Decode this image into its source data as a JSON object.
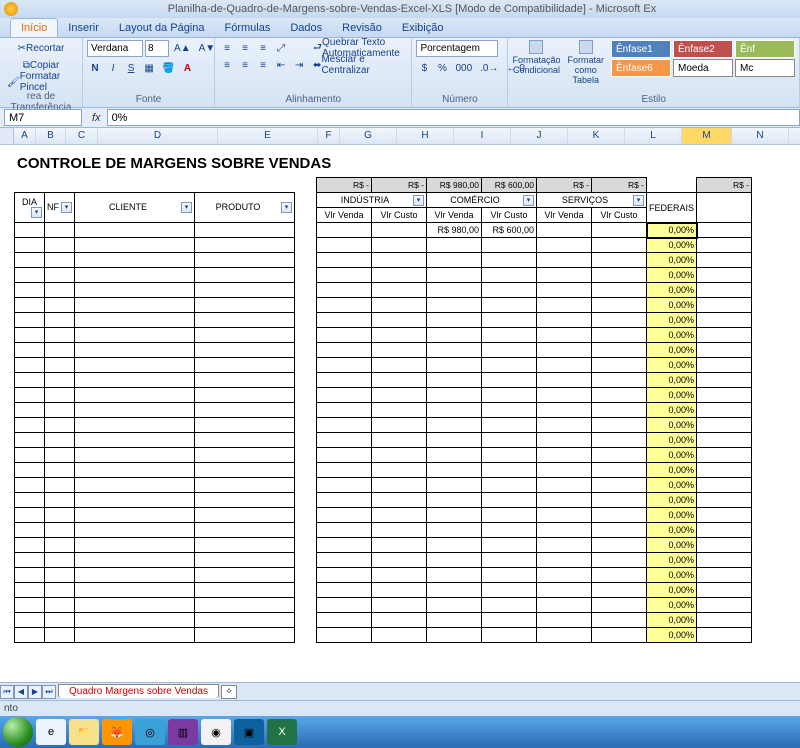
{
  "titlebar": {
    "text": "Planilha-de-Quadro-de-Margens-sobre-Vendas-Excel-XLS  [Modo de Compatibilidade] - Microsoft Ex"
  },
  "tabs": [
    "Início",
    "Inserir",
    "Layout da Página",
    "Fórmulas",
    "Dados",
    "Revisão",
    "Exibição"
  ],
  "active_tab": 0,
  "ribbon": {
    "clipboard": {
      "cut": "Recortar",
      "copy": "Copiar",
      "painter": "Formatar Pincel",
      "label": "rea de Transferência"
    },
    "font": {
      "name": "Verdana",
      "size": "8",
      "label": "Fonte"
    },
    "alignment": {
      "wrap": "Quebrar Texto Automaticamente",
      "merge": "Mesclar e Centralizar",
      "label": "Alinhamento"
    },
    "number": {
      "format": "Porcentagem",
      "label": "Número"
    },
    "styles": {
      "cond": "Formatação Condicional",
      "table": "Formatar como Tabela",
      "chips": [
        "Ênfase1",
        "Ênfase2",
        "Ênfase6",
        "Moeda"
      ],
      "label": "Estilo"
    }
  },
  "formula": {
    "cell": "M7",
    "value": "0%"
  },
  "columns": [
    "A",
    "B",
    "C",
    "D",
    "E",
    "F",
    "G",
    "H",
    "I",
    "J",
    "K",
    "L",
    "M",
    "N"
  ],
  "report": {
    "title": "CONTROLE DE MARGENS SOBRE VENDAS",
    "headers": {
      "dia": "DIA",
      "nf": "NF",
      "cliente": "CLIENTE",
      "produto": "PRODUTO",
      "groups": [
        "INDÚSTRIA",
        "COMÉRCIO",
        "SERVIÇOS"
      ],
      "vlr_venda": "Vlr Venda",
      "vlr_custo": "Vlr Custo",
      "federais": "FEDERAIS"
    },
    "summary_row": {
      "g": "R$          -",
      "h": "R$          -",
      "i": "R$    980,00",
      "j": "R$    600,00",
      "k": "R$          -",
      "l": "R$          -",
      "n": "R$          -"
    },
    "data_row": {
      "i": "R$    980,00",
      "j": "R$    600,00"
    },
    "pct": "0,00%",
    "empty_rows": 28
  },
  "sheet_tab": "Quadro Margens sobre Vendas",
  "status": "nto"
}
